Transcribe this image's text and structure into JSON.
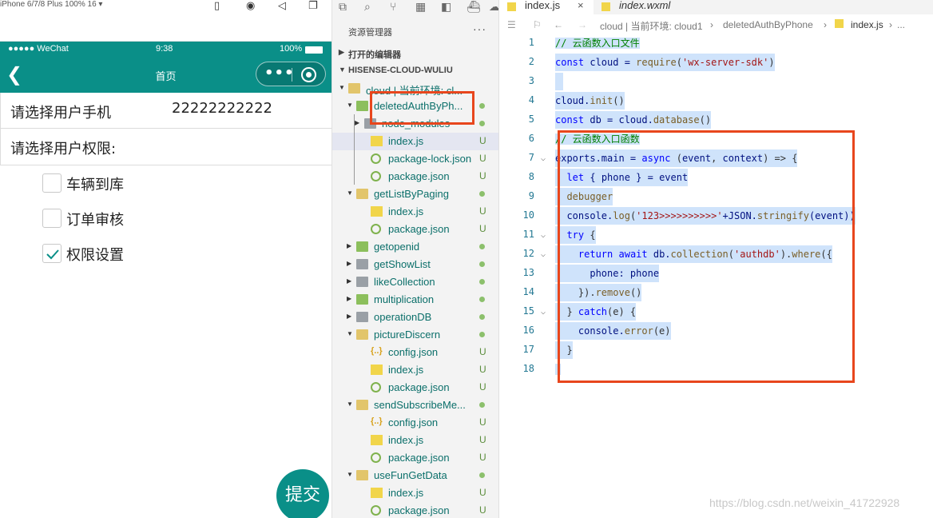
{
  "simulator": {
    "device_label": "iPhone 6/7/8 Plus 100% 16 ▾",
    "status": {
      "carrier": "●●●●● WeChat",
      "time": "9:38",
      "battery": "100%"
    },
    "nav_title": "首页",
    "phone_row": {
      "label": "请选择用户手机",
      "value": "22222222222"
    },
    "perm_row": {
      "label": "请选择用户权限:"
    },
    "checkboxes": [
      {
        "label": "车辆到库",
        "checked": false
      },
      {
        "label": "订单审核",
        "checked": false
      },
      {
        "label": "权限设置",
        "checked": true
      }
    ],
    "submit_label": "提交"
  },
  "explorer": {
    "title": "资源管理器",
    "more": "···",
    "open_editors": "打开的编辑器",
    "project": "HISENSE-CLOUD-WULIU",
    "tree": [
      {
        "label": "cloud | 当前环境: cl...",
        "badge": ""
      },
      {
        "label": "deletedAuthByPh...",
        "badge": "●"
      },
      {
        "label": "node_modules",
        "badge": "●"
      },
      {
        "label": "index.js",
        "badge": "U"
      },
      {
        "label": "package-lock.json",
        "badge": "U"
      },
      {
        "label": "package.json",
        "badge": "U"
      },
      {
        "label": "getListByPaging",
        "badge": "●"
      },
      {
        "label": "index.js",
        "badge": "U"
      },
      {
        "label": "package.json",
        "badge": "U"
      },
      {
        "label": "getopenid",
        "badge": "●"
      },
      {
        "label": "getShowList",
        "badge": "●"
      },
      {
        "label": "likeCollection",
        "badge": "●"
      },
      {
        "label": "multiplication",
        "badge": "●"
      },
      {
        "label": "operationDB",
        "badge": "●"
      },
      {
        "label": "pictureDiscern",
        "badge": "●"
      },
      {
        "label": "config.json",
        "badge": "U"
      },
      {
        "label": "index.js",
        "badge": "U"
      },
      {
        "label": "package.json",
        "badge": "U"
      },
      {
        "label": "sendSubscribeMe...",
        "badge": "●"
      },
      {
        "label": "config.json",
        "badge": "U"
      },
      {
        "label": "index.js",
        "badge": "U"
      },
      {
        "label": "package.json",
        "badge": "U"
      },
      {
        "label": "useFunGetData",
        "badge": "●"
      },
      {
        "label": "index.js",
        "badge": "U"
      },
      {
        "label": "package.json",
        "badge": "U"
      }
    ]
  },
  "editor": {
    "tabs": [
      {
        "label": "index.js",
        "close": "×"
      },
      {
        "label": "index.wxml"
      }
    ],
    "breadcrumb": {
      "cloud": "cloud | 当前环境: cloud1",
      "folder": "deletedAuthByPhone",
      "file": "index.js",
      "tail": "..."
    },
    "line_numbers": [
      "1",
      "2",
      "3",
      "4",
      "5",
      "6",
      "7",
      "8",
      "9",
      "10",
      "11",
      "12",
      "13",
      "14",
      "15",
      "16",
      "17",
      "18"
    ],
    "lines": {
      "l1": "// 云函数入口文件",
      "l2": [
        "const",
        " cloud = ",
        "require",
        "(",
        "'wx-server-sdk'",
        ")"
      ],
      "l4": [
        "cloud.",
        "init",
        "()"
      ],
      "l5": [
        "const",
        " db = cloud.",
        "database",
        "()"
      ],
      "l6": "// 云函数入口函数",
      "l7": [
        "exports.main = ",
        "async",
        " (",
        "event",
        ", ",
        "context",
        ") => {"
      ],
      "l8": [
        "  ",
        "let",
        " { phone } = ",
        "event"
      ],
      "l9": "  debugger",
      "l10": [
        "  console.",
        "log",
        "(",
        "'123>>>>>>>>>>'",
        "+JSON.",
        "stringify",
        "(event))"
      ],
      "l11": [
        "  ",
        "try",
        " {"
      ],
      "l12": [
        "    ",
        "return",
        " ",
        "await",
        " db.",
        "collection",
        "(",
        "'authdb'",
        ").",
        "where",
        "({"
      ],
      "l13": "      phone: phone",
      "l14": [
        "    }).",
        "remove",
        "()"
      ],
      "l15": [
        "  } ",
        "catch",
        "(e) {"
      ],
      "l16": [
        "    console.",
        "error",
        "(e)"
      ],
      "l17": "  }",
      "l18": "}"
    }
  },
  "watermark": "https://blog.csdn.net/weixin_41722928",
  "colors": {
    "brand": "#0a8f88",
    "highlight_box": "#e8461d",
    "selection": "#cfe3fb"
  }
}
